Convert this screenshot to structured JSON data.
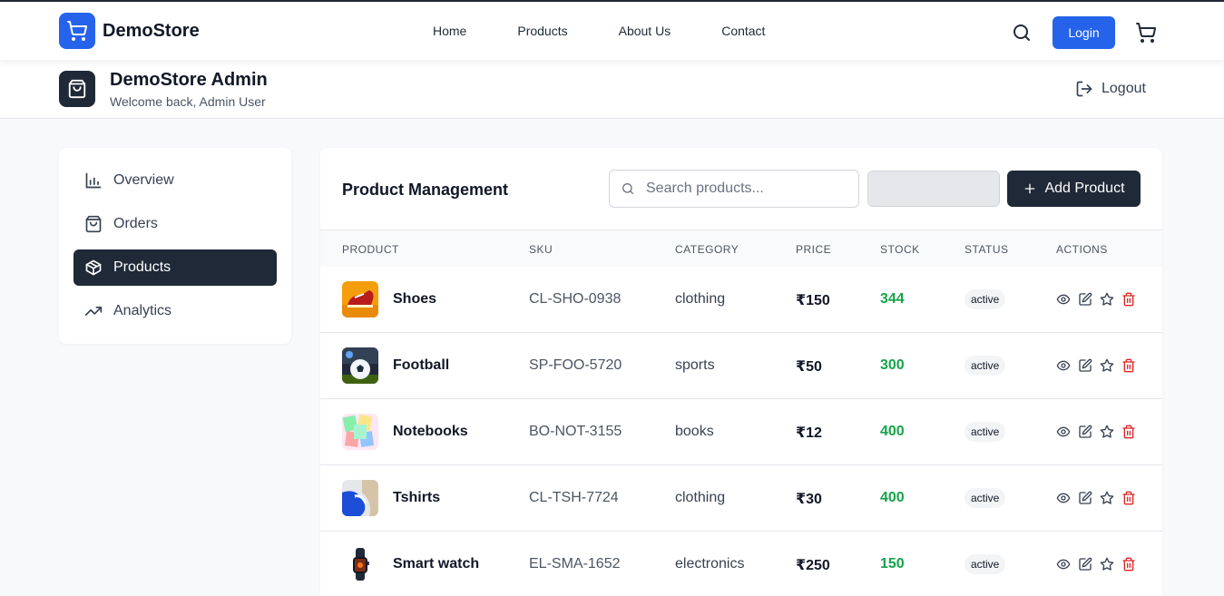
{
  "topnav": {
    "brand": "DemoStore",
    "links": [
      "Home",
      "Products",
      "About Us",
      "Contact"
    ],
    "login_label": "Login",
    "accent": "#2563eb"
  },
  "admin": {
    "title": "DemoStore Admin",
    "subtitle": "Welcome back, Admin User",
    "logout_label": "Logout"
  },
  "sidebar": {
    "items": [
      {
        "label": "Overview",
        "icon": "bar-chart-icon",
        "active": false
      },
      {
        "label": "Orders",
        "icon": "shopping-bag-icon",
        "active": false
      },
      {
        "label": "Products",
        "icon": "package-icon",
        "active": true
      },
      {
        "label": "Analytics",
        "icon": "trending-up-icon",
        "active": false
      }
    ]
  },
  "main": {
    "title": "Product Management",
    "search_placeholder": "Search products...",
    "add_label": "Add Product",
    "columns": [
      "PRODUCT",
      "SKU",
      "CATEGORY",
      "PRICE",
      "STOCK",
      "STATUS",
      "ACTIONS"
    ],
    "rows": [
      {
        "name": "Shoes",
        "sku": "CL-SHO-0938",
        "category": "clothing",
        "price": "₹150",
        "stock": "344",
        "status": "active",
        "thumb": "shoe-image"
      },
      {
        "name": "Football",
        "sku": "SP-FOO-5720",
        "category": "sports",
        "price": "₹50",
        "stock": "300",
        "status": "active",
        "thumb": "football-image"
      },
      {
        "name": "Notebooks",
        "sku": "BO-NOT-3155",
        "category": "books",
        "price": "₹12",
        "stock": "400",
        "status": "active",
        "thumb": "notebook-image"
      },
      {
        "name": "Tshirts",
        "sku": "CL-TSH-7724",
        "category": "clothing",
        "price": "₹30",
        "stock": "400",
        "status": "active",
        "thumb": "tshirt-image"
      },
      {
        "name": "Smart watch",
        "sku": "EL-SMA-1652",
        "category": "electronics",
        "price": "₹250",
        "stock": "150",
        "status": "active",
        "thumb": "smartwatch-image"
      }
    ]
  },
  "colors": {
    "dark": "#1f2937",
    "stock_green": "#16a34a",
    "delete_red": "#dc2626"
  }
}
